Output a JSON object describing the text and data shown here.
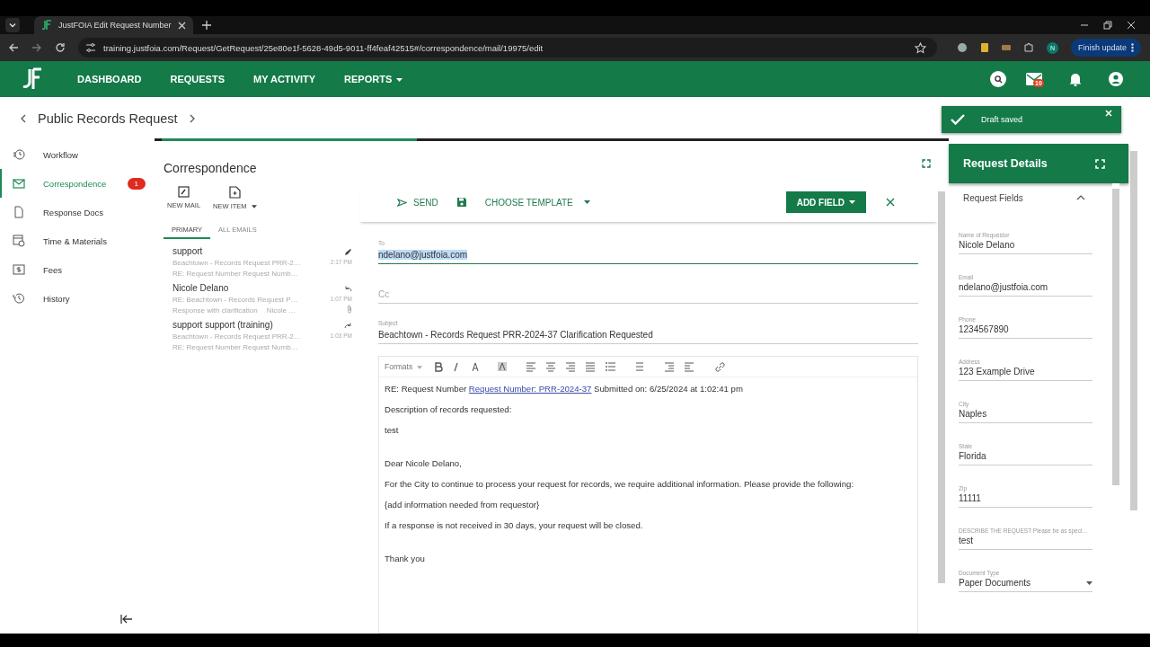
{
  "browser": {
    "tab_title": "JustFOIA Edit Request Number",
    "url": "training.justfoia.com/Request/GetRequest/25e80e1f-5628-49d5-9011-ff4feaf42515#/correspondence/mail/19975/edit",
    "profile": "N",
    "update": "Finish update"
  },
  "nav": {
    "items": [
      {
        "label": "DASHBOARD",
        "dropdown": false
      },
      {
        "label": "REQUESTS",
        "dropdown": false
      },
      {
        "label": "MY ACTIVITY",
        "dropdown": false
      },
      {
        "label": "REPORTS",
        "dropdown": true
      }
    ],
    "mail_badge": "10"
  },
  "toast": {
    "text": "Draft saved"
  },
  "breadcrumb": {
    "title": "Public Records Request"
  },
  "sidebar": {
    "items": [
      {
        "label": "Workflow",
        "kind": "workflow",
        "selected": false
      },
      {
        "label": "Correspondence",
        "kind": "mail",
        "selected": true,
        "badge": "1"
      },
      {
        "label": "Response Docs",
        "kind": "doc",
        "selected": false
      },
      {
        "label": "Time & Materials",
        "kind": "time",
        "selected": false
      },
      {
        "label": "Fees",
        "kind": "fees",
        "selected": false
      },
      {
        "label": "History",
        "kind": "history",
        "selected": false
      }
    ]
  },
  "correspondence": {
    "title": "Correspondence",
    "actions": [
      {
        "label": "NEW MAIL",
        "kind": "mail",
        "dropdown": false
      },
      {
        "label": "NEW ITEM",
        "kind": "item",
        "dropdown": true
      }
    ],
    "tabs": [
      {
        "label": "PRIMARY",
        "selected": true
      },
      {
        "label": "ALL EMAILS",
        "selected": false
      }
    ],
    "messages": [
      {
        "sender": "support",
        "subject": "Beachtown - Records Request PRR-2…",
        "preview": "RE: Request Number Request Numb…",
        "time": "2:17 PM",
        "kind": "draft",
        "attachment": false
      },
      {
        "sender": "Nicole Delano",
        "subject": "RE: Beachtown - Records Request P…",
        "preview": "Response with clarification",
        "preview_from": "Nicole …",
        "time": "1:07 PM",
        "kind": "reply",
        "attachment": true
      },
      {
        "sender": "support support (training)",
        "subject": "Beachtown - Records Request PRR-2…",
        "preview": "RE: Request Number Request Numb…",
        "time": "1:03 PM",
        "kind": "forward",
        "attachment": false
      }
    ]
  },
  "composer": {
    "send": "SEND",
    "template": "CHOOSE TEMPLATE",
    "add_field": "ADD FIELD",
    "to": {
      "label": "To",
      "value": "ndelano@justfoia.com"
    },
    "cc": {
      "placeholder": "Cc"
    },
    "subject": {
      "label": "Subject",
      "value": "Beachtown - Records Request PRR-2024-37 Clarification Requested"
    },
    "formats": "Formats",
    "body": [
      {
        "kind": "link",
        "before": "RE: Request Number ",
        "link": "Request Number: PRR-2024-37",
        "after": " Submitted on: 6/25/2024 at 1:02:41 pm"
      },
      {
        "kind": "text",
        "text": "Description of records requested:"
      },
      {
        "kind": "text",
        "text": "test"
      },
      {
        "kind": "blank"
      },
      {
        "kind": "text",
        "text": "Dear Nicole Delano,"
      },
      {
        "kind": "text",
        "text": "For the City to continue to process your request for records, we require additional information. Please provide the following:"
      },
      {
        "kind": "text",
        "text": "{add information needed from requestor}"
      },
      {
        "kind": "text",
        "text": "If a response is not received in 30 days, your request will be closed."
      },
      {
        "kind": "blank"
      },
      {
        "kind": "text",
        "text": "Thank you"
      }
    ]
  },
  "details": {
    "title": "Request Details",
    "section": "Request Fields",
    "expanded": true,
    "fields": [
      {
        "label": "Name of Requestor",
        "value": "Nicole Delano",
        "kind": "text"
      },
      {
        "label": "Email",
        "value": "ndelano@justfoia.com",
        "kind": "text"
      },
      {
        "label": "Phone",
        "value": "1234567890",
        "kind": "text"
      },
      {
        "label": "Address",
        "value": "123 Example Drive",
        "kind": "text"
      },
      {
        "label": "City",
        "value": "Naples",
        "kind": "text"
      },
      {
        "label": "State",
        "value": "Florida",
        "kind": "text"
      },
      {
        "label": "Zip",
        "value": "11111",
        "kind": "text"
      },
      {
        "label": "DESCRIBE THE REQUEST Please be as speci…",
        "value": "test",
        "kind": "text"
      },
      {
        "label": "Document Type",
        "value": "Paper Documents",
        "kind": "select"
      }
    ]
  }
}
